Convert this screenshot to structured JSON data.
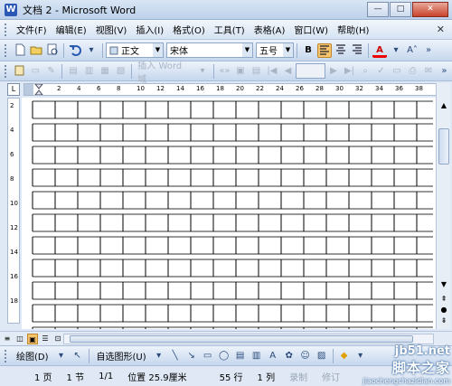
{
  "window": {
    "title": "文档 2 - Microsoft Word",
    "app_icon": "W",
    "buttons": {
      "minimize": "—",
      "maximize": "□",
      "close": "✕"
    }
  },
  "menubar": {
    "items": [
      "文件(F)",
      "编辑(E)",
      "视图(V)",
      "插入(I)",
      "格式(O)",
      "工具(T)",
      "表格(A)",
      "窗口(W)",
      "帮助(H)"
    ],
    "close_glyph": "✕"
  },
  "format_toolbar": {
    "style": "正文",
    "font": "宋体",
    "size": "五号",
    "bold": "B",
    "font_color_letter": "A"
  },
  "mail_toolbar": {
    "insert_word_field": "插入 Word 域"
  },
  "ruler": {
    "corner_glyph": "L",
    "marks": [
      "2",
      "4",
      "6",
      "8",
      "10",
      "12",
      "14",
      "16",
      "18",
      "20",
      "22",
      "24",
      "26",
      "28",
      "30",
      "32",
      "34",
      "36",
      "38"
    ],
    "vertical_marks": [
      "2",
      "4",
      "6",
      "8",
      "10",
      "12",
      "14",
      "16",
      "18"
    ]
  },
  "grid": {
    "line_color": "#000000",
    "double_line_color": "#333333"
  },
  "drawing_toolbar": {
    "draw_label": "绘图(D)",
    "autoshapes_label": "自选图形(U)"
  },
  "status": {
    "page": "1 页",
    "section": "1 节",
    "page_of": "1/1",
    "position": "位置 25.9厘米",
    "line": "55 行",
    "column": "1 列",
    "record": "录制",
    "revision": "修订"
  },
  "watermark": {
    "line1": "jb51.net",
    "line2": "脚本之家",
    "line3": "jiaochengchazidian.com"
  },
  "colors": {
    "title_gradient": "#bcd1ea",
    "toolbar": "#c6d7ed",
    "active_button": "#f6c46a"
  }
}
